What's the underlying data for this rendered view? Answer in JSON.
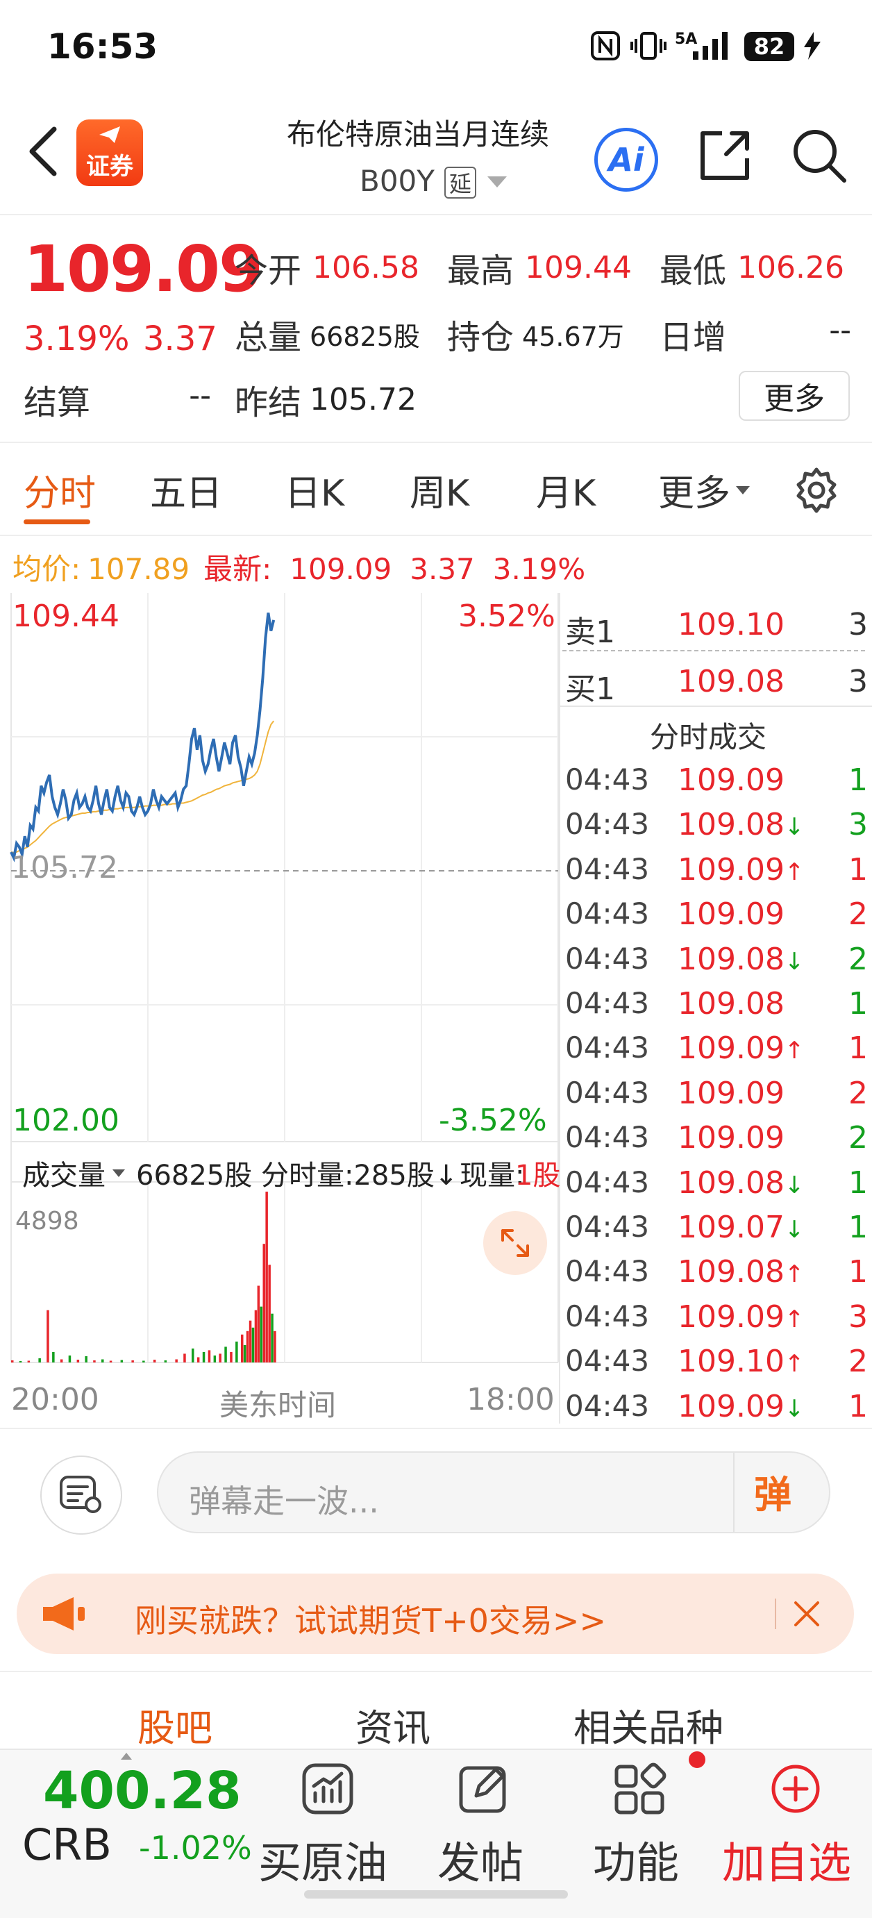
{
  "status_bar": {
    "time": "16:53",
    "network": "5A",
    "battery": "82"
  },
  "header": {
    "logo_label": "证券",
    "title": "布伦特原油当月连续",
    "code": "B00Y",
    "delay_badge": "延"
  },
  "quote": {
    "last_price": "109.09",
    "pct_change": "3.19%",
    "abs_change": "3.37",
    "fields": [
      {
        "label": "今开",
        "value": "106.58"
      },
      {
        "label": "最高",
        "value": "109.44"
      },
      {
        "label": "最低",
        "value": "106.26"
      },
      {
        "label": "总量",
        "value": "66825股"
      },
      {
        "label": "持仓",
        "value": "45.67万"
      },
      {
        "label": "日增",
        "value": "--"
      },
      {
        "label": "结算",
        "value": "--"
      },
      {
        "label": "昨结",
        "value": "105.72"
      }
    ],
    "more_label": "更多"
  },
  "chart_tabs": [
    "分时",
    "五日",
    "日K",
    "周K",
    "月K",
    "更多"
  ],
  "info_bar": {
    "avg_label": "均价:",
    "avg_value": "107.89",
    "latest_label": "最新:",
    "latest_value": "109.09",
    "change": "3.37",
    "pct": "3.19%"
  },
  "chart_data": {
    "type": "line",
    "y_top": "109.44",
    "y_mid": "105.72",
    "y_bottom": "102.00",
    "pct_top": "3.52%",
    "pct_bottom": "-3.52%",
    "ylim": [
      102.0,
      109.44
    ],
    "series": [
      {
        "values": [
          105.98,
          105.9,
          106.1,
          106.05,
          105.95,
          106.2,
          106.05,
          106.35,
          106.3,
          106.6,
          106.55,
          106.9,
          106.8,
          106.95,
          107.05,
          106.75,
          106.6,
          106.5,
          106.65,
          106.85,
          106.7,
          106.45,
          106.5,
          106.7,
          106.8,
          106.6,
          106.65,
          106.75,
          106.6,
          106.55,
          106.7,
          106.9,
          106.65,
          106.5,
          106.7,
          106.85,
          106.6,
          106.55,
          106.75,
          106.9,
          106.7,
          106.6,
          106.8,
          106.75,
          106.55,
          106.5,
          106.6,
          106.75,
          106.6,
          106.5,
          106.55,
          106.65,
          106.85,
          106.7,
          106.6,
          106.75,
          106.7,
          106.65,
          106.7,
          106.75,
          106.8,
          106.6,
          106.7,
          106.85,
          106.9,
          107.2,
          107.55,
          107.7,
          107.4,
          107.6,
          107.25,
          107.1,
          107.2,
          107.4,
          107.55,
          107.3,
          107.1,
          107.3,
          107.5,
          107.35,
          107.2,
          107.5,
          107.6,
          107.3,
          107.15,
          106.9,
          107.1,
          107.3,
          107.2,
          107.35,
          107.6,
          107.95,
          108.4,
          108.95,
          109.3,
          109.05,
          109.2
        ]
      },
      {
        "values": [
          105.98,
          105.97,
          105.98,
          106.0,
          106.01,
          106.03,
          106.05,
          106.08,
          106.11,
          106.14,
          106.18,
          106.22,
          106.26,
          106.3,
          106.34,
          106.37,
          106.39,
          106.41,
          106.43,
          106.45,
          106.46,
          106.47,
          106.48,
          106.49,
          106.5,
          106.51,
          106.52,
          106.52,
          106.53,
          106.53,
          106.54,
          106.54,
          106.55,
          106.55,
          106.56,
          106.56,
          106.57,
          106.57,
          106.58,
          106.58,
          106.59,
          106.59,
          106.6,
          106.6,
          106.6,
          106.6,
          106.61,
          106.61,
          106.61,
          106.62,
          106.62,
          106.62,
          106.63,
          106.63,
          106.63,
          106.63,
          106.64,
          106.64,
          106.64,
          106.65,
          106.65,
          106.65,
          106.66,
          106.66,
          106.67,
          106.68,
          106.69,
          106.71,
          106.73,
          106.75,
          106.77,
          106.78,
          106.8,
          106.81,
          106.83,
          106.85,
          106.86,
          106.88,
          106.9,
          106.91,
          106.92,
          106.94,
          106.95,
          106.96,
          106.97,
          106.98,
          106.99,
          107.0,
          107.02,
          107.05,
          107.1,
          107.2,
          107.35,
          107.5,
          107.65,
          107.75,
          107.8
        ]
      }
    ]
  },
  "order_book": [
    {
      "label": "卖1",
      "price": "109.10",
      "volume": "3"
    },
    {
      "label": "买1",
      "price": "109.08",
      "volume": "3"
    }
  ],
  "trades_title": "分时成交",
  "trades": [
    {
      "time": "04:43",
      "price": "109.09",
      "dir": "",
      "volume": "1",
      "vcolor": "green"
    },
    {
      "time": "04:43",
      "price": "109.08",
      "dir": "↓",
      "volume": "3",
      "vcolor": "green"
    },
    {
      "time": "04:43",
      "price": "109.09",
      "dir": "↑",
      "volume": "1",
      "vcolor": "red"
    },
    {
      "time": "04:43",
      "price": "109.09",
      "dir": "",
      "volume": "2",
      "vcolor": "red"
    },
    {
      "time": "04:43",
      "price": "109.08",
      "dir": "↓",
      "volume": "2",
      "vcolor": "green"
    },
    {
      "time": "04:43",
      "price": "109.08",
      "dir": "",
      "volume": "1",
      "vcolor": "green"
    },
    {
      "time": "04:43",
      "price": "109.09",
      "dir": "↑",
      "volume": "1",
      "vcolor": "red"
    },
    {
      "time": "04:43",
      "price": "109.09",
      "dir": "",
      "volume": "2",
      "vcolor": "red"
    },
    {
      "time": "04:43",
      "price": "109.09",
      "dir": "",
      "volume": "2",
      "vcolor": "green"
    },
    {
      "time": "04:43",
      "price": "109.08",
      "dir": "↓",
      "volume": "1",
      "vcolor": "green"
    },
    {
      "time": "04:43",
      "price": "109.07",
      "dir": "↓",
      "volume": "1",
      "vcolor": "green"
    },
    {
      "time": "04:43",
      "price": "109.08",
      "dir": "↑",
      "volume": "1",
      "vcolor": "red"
    },
    {
      "time": "04:43",
      "price": "109.09",
      "dir": "↑",
      "volume": "3",
      "vcolor": "red"
    },
    {
      "time": "04:43",
      "price": "109.10",
      "dir": "↑",
      "volume": "2",
      "vcolor": "red"
    },
    {
      "time": "04:43",
      "price": "109.09",
      "dir": "↓",
      "volume": "1",
      "vcolor": "red"
    }
  ],
  "volume": {
    "dropdown_label": "成交量",
    "total": "66825股",
    "minute": "分时量:285股↓",
    "current_label": "现量:",
    "current_value": "1股",
    "max_label": "4898",
    "bars": [
      {
        "i": 0,
        "v": 60,
        "c": "red"
      },
      {
        "i": 3,
        "v": 40,
        "c": "green"
      },
      {
        "i": 6,
        "v": 50,
        "c": "red"
      },
      {
        "i": 10,
        "v": 120,
        "c": "green"
      },
      {
        "i": 13,
        "v": 1500,
        "c": "red"
      },
      {
        "i": 15,
        "v": 300,
        "c": "green"
      },
      {
        "i": 18,
        "v": 90,
        "c": "red"
      },
      {
        "i": 21,
        "v": 200,
        "c": "green"
      },
      {
        "i": 24,
        "v": 80,
        "c": "red"
      },
      {
        "i": 27,
        "v": 180,
        "c": "green"
      },
      {
        "i": 30,
        "v": 60,
        "c": "red"
      },
      {
        "i": 33,
        "v": 90,
        "c": "green"
      },
      {
        "i": 36,
        "v": 50,
        "c": "red"
      },
      {
        "i": 40,
        "v": 70,
        "c": "green"
      },
      {
        "i": 44,
        "v": 60,
        "c": "red"
      },
      {
        "i": 48,
        "v": 50,
        "c": "green"
      },
      {
        "i": 52,
        "v": 80,
        "c": "red"
      },
      {
        "i": 56,
        "v": 60,
        "c": "green"
      },
      {
        "i": 60,
        "v": 90,
        "c": "red"
      },
      {
        "i": 63,
        "v": 250,
        "c": "red"
      },
      {
        "i": 66,
        "v": 400,
        "c": "green"
      },
      {
        "i": 68,
        "v": 150,
        "c": "red"
      },
      {
        "i": 70,
        "v": 300,
        "c": "green"
      },
      {
        "i": 72,
        "v": 350,
        "c": "red"
      },
      {
        "i": 74,
        "v": 200,
        "c": "green"
      },
      {
        "i": 76,
        "v": 250,
        "c": "red"
      },
      {
        "i": 78,
        "v": 450,
        "c": "green"
      },
      {
        "i": 80,
        "v": 300,
        "c": "red"
      },
      {
        "i": 82,
        "v": 600,
        "c": "green"
      },
      {
        "i": 84,
        "v": 800,
        "c": "red"
      },
      {
        "i": 85,
        "v": 500,
        "c": "green"
      },
      {
        "i": 86,
        "v": 900,
        "c": "red"
      },
      {
        "i": 87,
        "v": 1200,
        "c": "red"
      },
      {
        "i": 88,
        "v": 1000,
        "c": "green"
      },
      {
        "i": 89,
        "v": 1500,
        "c": "red"
      },
      {
        "i": 90,
        "v": 2200,
        "c": "red"
      },
      {
        "i": 91,
        "v": 1600,
        "c": "green"
      },
      {
        "i": 92,
        "v": 3400,
        "c": "red"
      },
      {
        "i": 93,
        "v": 4898,
        "c": "red"
      },
      {
        "i": 94,
        "v": 2800,
        "c": "red"
      },
      {
        "i": 95,
        "v": 1400,
        "c": "green"
      },
      {
        "i": 96,
        "v": 900,
        "c": "red"
      }
    ]
  },
  "time_axis": {
    "start": "20:00",
    "zone": "美东时间",
    "end": "18:00"
  },
  "danmu": {
    "placeholder": "弹幕走一波...",
    "send_label": "弹"
  },
  "promo": {
    "text": "刚买就跌？试试期货T+0交易>>"
  },
  "section_tabs": [
    "股吧",
    "资讯",
    "相关品种"
  ],
  "bottom": {
    "crb_value": "400.28",
    "crb_name": "CRB",
    "crb_change": "-1.02%",
    "buttons": [
      "买原油",
      "发帖",
      "功能",
      "加自选"
    ]
  },
  "colors": {
    "red": "#e8252b",
    "green": "#13a01e",
    "accent": "#e65a14",
    "blue_line": "#2e6db4",
    "avg_line": "#f0b43c"
  }
}
